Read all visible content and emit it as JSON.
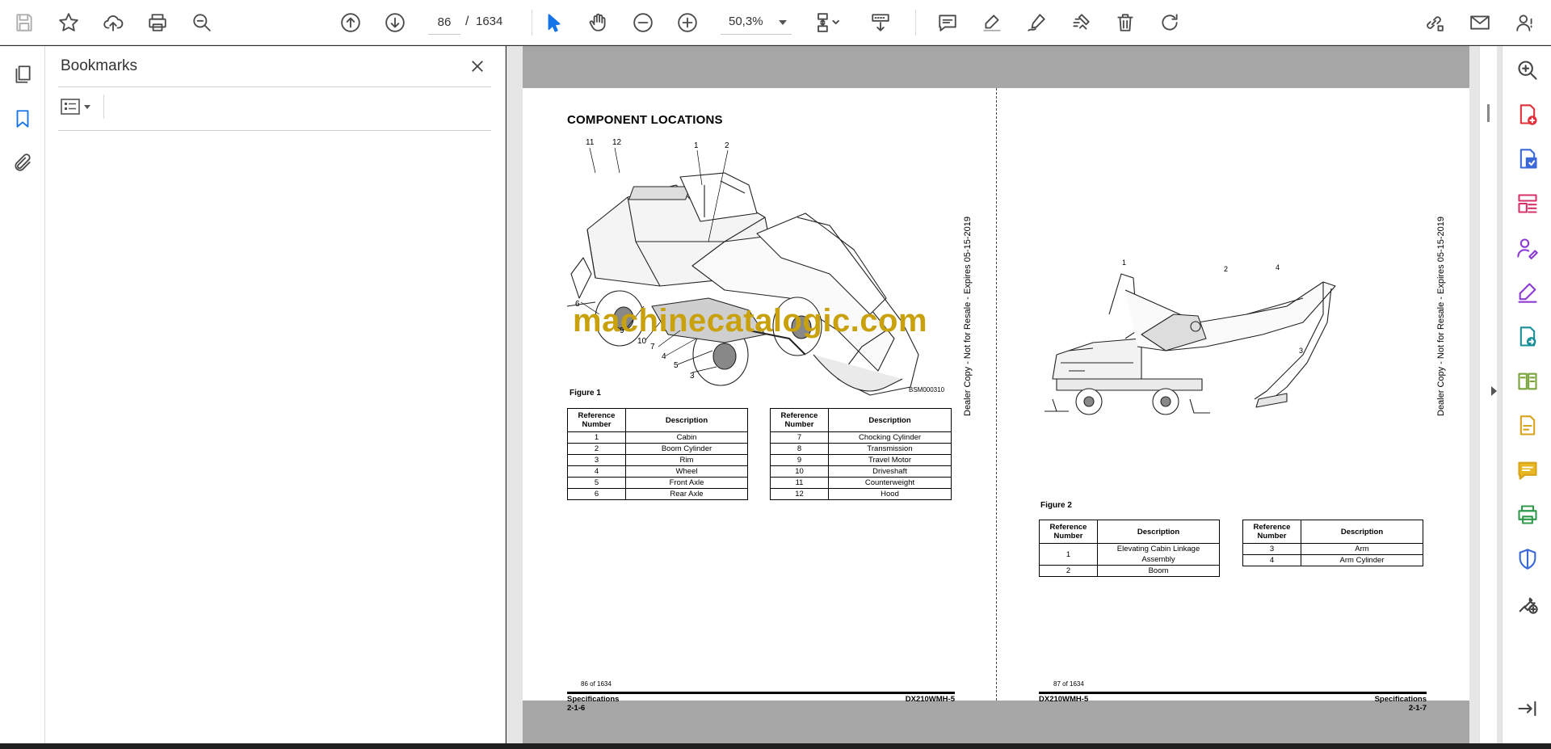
{
  "toolbar": {
    "page_current": "86",
    "page_total": "1634",
    "zoom": "50,3%"
  },
  "bookmarks": {
    "title": "Bookmarks"
  },
  "left_page": {
    "title": "COMPONENT LOCATIONS",
    "figure_label": "Figure 1",
    "figure_code": "BSM000310",
    "side_note": "Dealer Copy - Not for Resale - Expires 05-15-2019",
    "callouts": [
      "11",
      "12",
      "1",
      "2",
      "6",
      "9",
      "10",
      "7",
      "4",
      "5",
      "3"
    ],
    "table_headers": [
      "Reference Number",
      "Description"
    ],
    "table_a": [
      [
        "1",
        "Cabin"
      ],
      [
        "2",
        "Boom Cylinder"
      ],
      [
        "3",
        "Rim"
      ],
      [
        "4",
        "Wheel"
      ],
      [
        "5",
        "Front Axle"
      ],
      [
        "6",
        "Rear Axle"
      ]
    ],
    "table_b": [
      [
        "7",
        "Chocking Cylinder"
      ],
      [
        "8",
        "Transmission"
      ],
      [
        "9",
        "Travel Motor"
      ],
      [
        "10",
        "Driveshaft"
      ],
      [
        "11",
        "Counterweight"
      ],
      [
        "12",
        "Hood"
      ]
    ],
    "footer_left": "Specifications",
    "footer_left_sub": "2-1-6",
    "footer_right": "DX210WMH-5",
    "page_count": "86 of 1634"
  },
  "right_page": {
    "figure_label": "Figure 2",
    "side_note": "Dealer Copy - Not for Resale - Expires 05-15-2019",
    "callouts": [
      "1",
      "2",
      "4",
      "3"
    ],
    "table_headers": [
      "Reference Number",
      "Description"
    ],
    "table_a": [
      [
        "1",
        "Elevating Cabin Linkage Assembly"
      ],
      [
        "2",
        "Boom"
      ]
    ],
    "table_b": [
      [
        "3",
        "Arm"
      ],
      [
        "4",
        "Arm Cylinder"
      ]
    ],
    "footer_left": "DX210WMH-5",
    "footer_right": "Specifications",
    "footer_right_sub": "2-1-7",
    "page_count": "87 of 1634"
  },
  "watermark": "machinecatalogic.com",
  "icons": {
    "toolbar": [
      "save-icon",
      "bookmark-star-icon",
      "upload-cloud-icon",
      "print-icon",
      "search-zoom-icon",
      "page-up-icon",
      "page-down-icon",
      "select-cursor-icon",
      "hand-pan-icon",
      "zoom-out-icon",
      "zoom-in-icon",
      "fit-page-icon",
      "scroll-mode-icon",
      "comment-icon",
      "highlight-icon",
      "draw-icon",
      "fill-sign-icon",
      "delete-icon",
      "rotate-icon",
      "share-link-icon",
      "email-icon",
      "account-icon"
    ],
    "left_rail": [
      "pages-icon",
      "bookmarks-icon",
      "attachments-icon"
    ],
    "right_rail": [
      "zoom-search-icon",
      "create-pdf-icon",
      "export-pdf-icon",
      "organize-pages-icon",
      "request-signature-icon",
      "fill-sign-icon",
      "send-review-icon",
      "compare-icon",
      "edit-pdf-icon",
      "comment-icon",
      "print-production-icon",
      "protect-icon",
      "more-tools-icon",
      "collapse-rail-icon"
    ]
  },
  "colors": {
    "accent_blue": "#1473e6",
    "watermark": "#c9a10c"
  }
}
